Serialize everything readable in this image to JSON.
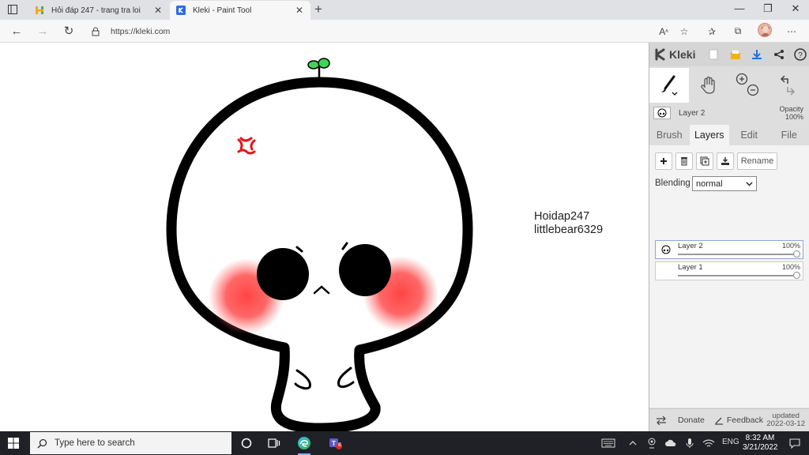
{
  "browser": {
    "tabs": [
      {
        "title": "Hỏi đáp 247 - trang tra loi",
        "active": false
      },
      {
        "title": "Kleki - Paint Tool",
        "active": true
      }
    ],
    "url": "https://kleki.com"
  },
  "canvas": {
    "text_line1": "Hoidap247",
    "text_line2": "littlebear6329"
  },
  "kleki": {
    "brand": "Kleki",
    "layer_name": "Layer 2",
    "opacity_label": "Opacity",
    "opacity_value": "100%",
    "tabs": [
      "Brush",
      "Layers",
      "Edit",
      "File"
    ],
    "active_tab": "Layers",
    "rename_label": "Rename",
    "blending_label": "Blending",
    "blending_value": "normal",
    "layers": [
      {
        "name": "Layer 2",
        "opacity": "100%",
        "selected": true
      },
      {
        "name": "Layer 1",
        "opacity": "100%",
        "selected": false
      }
    ],
    "footer": {
      "donate": "Donate",
      "feedback": "Feedback",
      "updated_line1": "updated",
      "updated_line2": "2022-03-12"
    }
  },
  "taskbar": {
    "search_placeholder": "Type here to search",
    "language": "ENG",
    "time": "8:32 AM",
    "date": "3/21/2022",
    "teams_badge": "8"
  },
  "colors": {
    "tabstrip": "#dfe1e5",
    "taskbar": "#1f2126",
    "sprout": "#3fd35a",
    "anger_mark": "#e0161b",
    "blush": "#ff4d4d"
  }
}
